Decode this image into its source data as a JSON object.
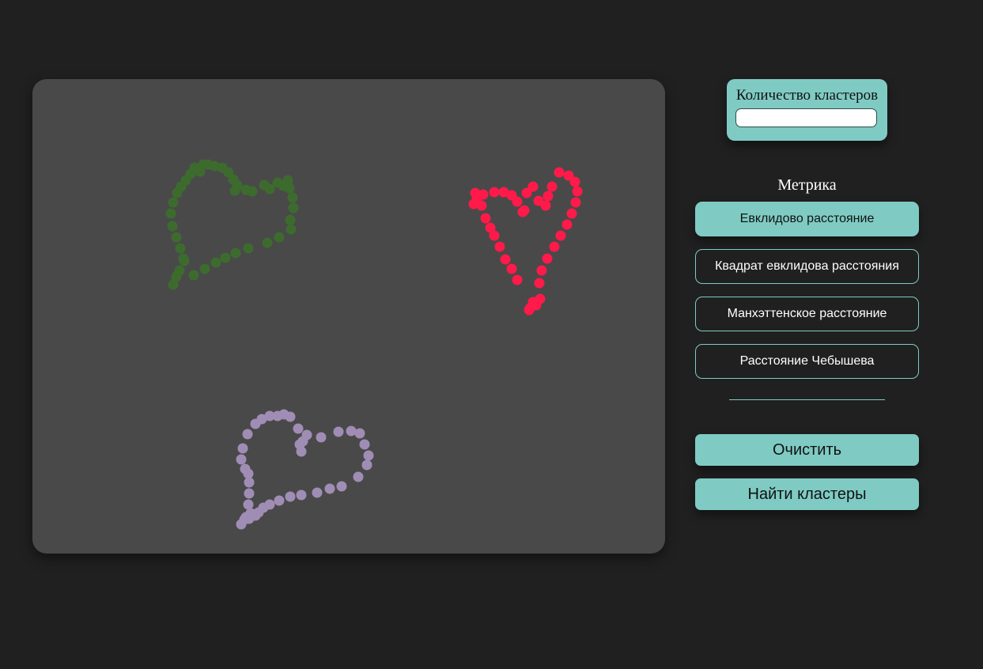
{
  "controls": {
    "cluster_count_label": "Количество кластеров",
    "cluster_count_value": "",
    "metric_title": "Метрика",
    "metrics": [
      {
        "label": "Евклидово расстояние",
        "selected": true
      },
      {
        "label": "Квадрат евклидова расстояния",
        "selected": false
      },
      {
        "label": "Манхэттенское расстояние",
        "selected": false
      },
      {
        "label": "Расстояние Чебышева",
        "selected": false
      }
    ],
    "clear_label": "Очистить",
    "find_label": "Найти кластеры"
  },
  "colors": {
    "background": "#202020",
    "canvas": "#494949",
    "accent": "#7fcbc4",
    "clusters": [
      "#3d6b2e",
      "#ff1a4a",
      "#a08db5"
    ]
  },
  "chart_data": {
    "type": "scatter",
    "xlim": [
      0,
      800
    ],
    "ylim": [
      0,
      600
    ],
    "grid": false,
    "series": [
      {
        "color": "#3d6b2e",
        "points": [
          [
            178,
            260
          ],
          [
            182,
            250
          ],
          [
            186,
            242
          ],
          [
            192,
            230
          ],
          [
            200,
            120
          ],
          [
            194,
            128
          ],
          [
            188,
            136
          ],
          [
            183,
            144
          ],
          [
            178,
            156
          ],
          [
            175,
            170
          ],
          [
            177,
            186
          ],
          [
            182,
            200
          ],
          [
            187,
            214
          ],
          [
            191,
            227
          ],
          [
            204,
            248
          ],
          [
            218,
            240
          ],
          [
            232,
            232
          ],
          [
            244,
            226
          ],
          [
            257,
            220
          ],
          [
            273,
            214
          ],
          [
            297,
            207
          ],
          [
            312,
            200
          ],
          [
            327,
            190
          ],
          [
            326,
            178
          ],
          [
            330,
            163
          ],
          [
            329,
            150
          ],
          [
            325,
            138
          ],
          [
            323,
            128
          ],
          [
            317,
            135
          ],
          [
            310,
            131
          ],
          [
            300,
            139
          ],
          [
            293,
            134
          ],
          [
            278,
            142
          ],
          [
            270,
            140
          ],
          [
            256,
            141
          ],
          [
            259,
            134
          ],
          [
            254,
            127
          ],
          [
            248,
            118
          ],
          [
            240,
            112
          ],
          [
            230,
            110
          ],
          [
            222,
            108
          ],
          [
            216,
            108
          ],
          [
            212,
            117
          ],
          [
            205,
            112
          ]
        ]
      },
      {
        "color": "#ff1a4a",
        "points": [
          [
            628,
            292
          ],
          [
            633,
            282
          ],
          [
            629,
            290
          ],
          [
            637,
            286
          ],
          [
            642,
            278
          ],
          [
            641,
            258
          ],
          [
            644,
            242
          ],
          [
            651,
            227
          ],
          [
            660,
            212
          ],
          [
            668,
            198
          ],
          [
            676,
            184
          ],
          [
            682,
            170
          ],
          [
            687,
            156
          ],
          [
            689,
            142
          ],
          [
            686,
            130
          ],
          [
            678,
            122
          ],
          [
            666,
            118
          ],
          [
            657,
            136
          ],
          [
            652,
            148
          ],
          [
            649,
            160
          ],
          [
            640,
            154
          ],
          [
            633,
            136
          ],
          [
            625,
            144
          ],
          [
            622,
            166
          ],
          [
            613,
            254
          ],
          [
            606,
            240
          ],
          [
            598,
            228
          ],
          [
            591,
            212
          ],
          [
            584,
            198
          ],
          [
            579,
            188
          ],
          [
            573,
            176
          ],
          [
            568,
            160
          ],
          [
            562,
            150
          ],
          [
            558,
            158
          ],
          [
            560,
            144
          ],
          [
            570,
            146
          ],
          [
            584,
            143
          ],
          [
            596,
            143
          ],
          [
            606,
            147
          ],
          [
            613,
            155
          ],
          [
            620,
            168
          ]
        ]
      },
      {
        "color": "#a08db5",
        "points": [
          [
            264,
            563
          ],
          [
            270,
            554
          ],
          [
            274,
            556
          ],
          [
            282,
            552
          ],
          [
            286,
            548
          ],
          [
            292,
            542
          ],
          [
            300,
            538
          ],
          [
            312,
            533
          ],
          [
            326,
            528
          ],
          [
            340,
            526
          ],
          [
            360,
            523
          ],
          [
            376,
            518
          ],
          [
            391,
            515
          ],
          [
            412,
            503
          ],
          [
            423,
            488
          ],
          [
            425,
            476
          ],
          [
            420,
            462
          ],
          [
            414,
            448
          ],
          [
            403,
            445
          ],
          [
            387,
            446
          ],
          [
            365,
            453
          ],
          [
            347,
            450
          ],
          [
            338,
            462
          ],
          [
            340,
            471
          ],
          [
            342,
            458
          ],
          [
            336,
            442
          ],
          [
            326,
            427
          ],
          [
            318,
            424
          ],
          [
            310,
            426
          ],
          [
            300,
            426
          ],
          [
            290,
            430
          ],
          [
            282,
            436
          ],
          [
            272,
            449
          ],
          [
            266,
            467
          ],
          [
            264,
            481
          ],
          [
            269,
            493
          ],
          [
            273,
            499
          ],
          [
            274,
            510
          ],
          [
            274,
            524
          ],
          [
            273,
            538
          ],
          [
            276,
            549
          ],
          [
            268,
            557
          ]
        ]
      }
    ]
  }
}
